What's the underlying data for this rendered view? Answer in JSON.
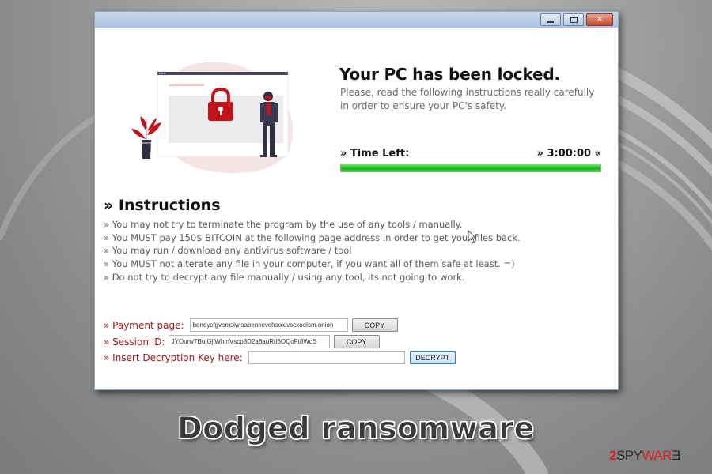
{
  "window": {
    "controls": {
      "minimize_icon": "minimize-icon",
      "maximize_icon": "maximize-icon",
      "close_glyph": "✕"
    }
  },
  "header": {
    "title": "Your PC has been locked.",
    "subtitle": "Please, read the following instructions really carefully in order to ensure your PC's safety."
  },
  "timer": {
    "label": "» Time Left:",
    "value": "» 3:00:00 «",
    "progress_percent": 100,
    "bar_color": "#2fcc2f"
  },
  "instructions": {
    "title": "» Instructions",
    "items": [
      "» You may not try to terminate the program by the use of any tools / manually.",
      "» You MUST pay 150$ BITCOIN at the following page address in order to get your files back.",
      "» You may run / download any antivirus software / tool",
      "» You MUST not alterate any file in your computer, if you want all of them safe at least.  =)",
      "» Do not try to decrypt any file manually / using any tool, its not going to work."
    ]
  },
  "form": {
    "payment": {
      "label": "» Payment page:",
      "value": "bdneysfgvemsiwlsabenncvehsoidvscxoelsm.onion",
      "button": "COPY"
    },
    "session": {
      "label": "» Session ID:",
      "value": "JYOunv7BuIGjlWhmVscp8D2a8auRtf6OQoFt8WqS",
      "button": "COPY"
    },
    "decrypt": {
      "label": "» Insert Decryption Key here:",
      "value": "",
      "button": "DECRYPT"
    },
    "label_color": "#a3171b"
  },
  "caption": "Dodged ransomware",
  "watermark": {
    "part1": "2SPYWAR",
    "part1_dark": "2SPY",
    "part1_red": "WAR",
    "part2": "Ǝ"
  },
  "colors": {
    "accent_red": "#c0141b",
    "title_text": "#111111"
  }
}
